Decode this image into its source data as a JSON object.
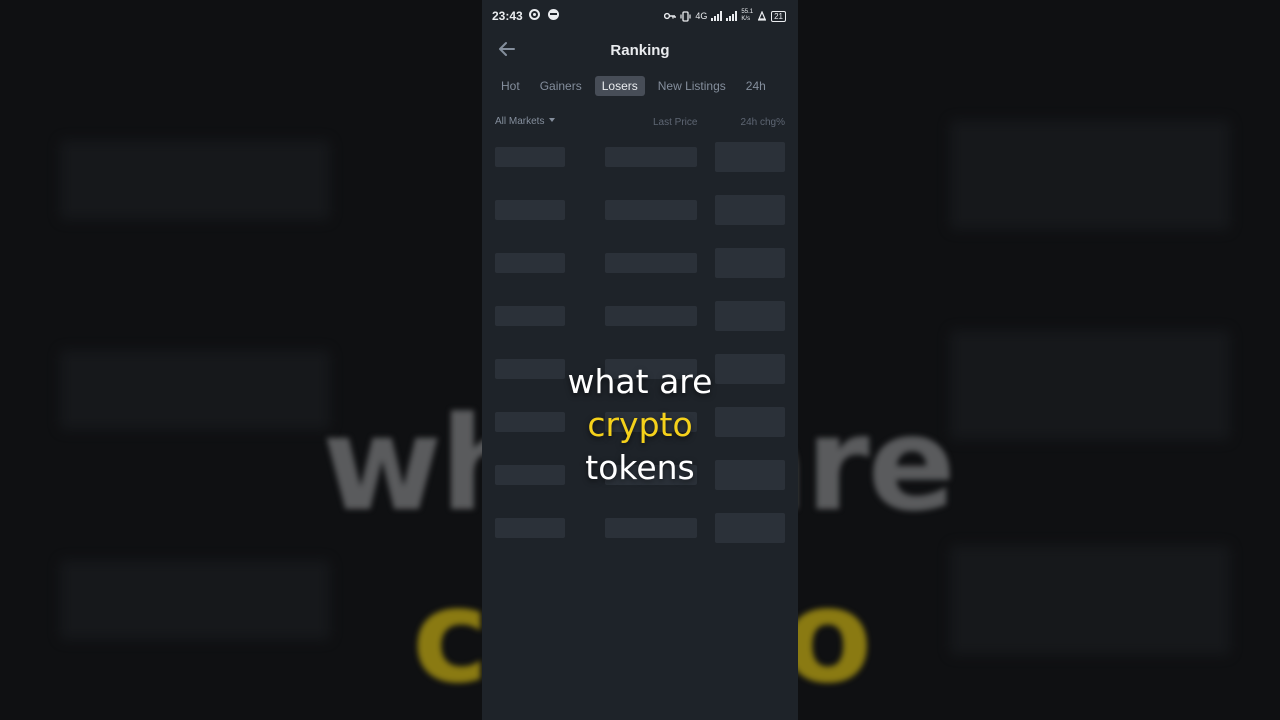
{
  "status_bar": {
    "time": "23:43",
    "network": "4G",
    "speed_value": "55.1",
    "speed_unit": "K/s",
    "battery": "21"
  },
  "header": {
    "title": "Ranking"
  },
  "tabs": [
    {
      "label": "Hot"
    },
    {
      "label": "Gainers"
    },
    {
      "label": "Losers",
      "active": true
    },
    {
      "label": "New Listings"
    },
    {
      "label": "24h"
    }
  ],
  "list": {
    "market_filter": "All Markets",
    "col_price": "Last Price",
    "col_change": "24h chg%"
  },
  "caption": {
    "line1": "what are",
    "line2": "crypto",
    "line3": "tokens"
  },
  "colors": {
    "background": "#1e2329",
    "skeleton": "#2b3139",
    "highlight": "#f5d11b"
  }
}
